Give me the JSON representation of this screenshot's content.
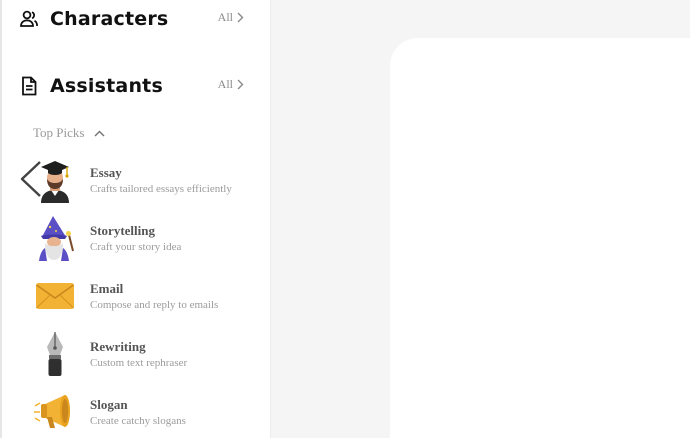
{
  "sections": {
    "characters": {
      "title": "Characters",
      "all_label": "All"
    },
    "assistants": {
      "title": "Assistants",
      "all_label": "All"
    }
  },
  "top_picks": {
    "label": "Top Picks"
  },
  "assistants_list": [
    {
      "name": "Essay",
      "description": "Crafts tailored essays efficiently",
      "icon": "graduate-icon"
    },
    {
      "name": "Storytelling",
      "description": "Craft your story idea",
      "icon": "wizard-icon"
    },
    {
      "name": "Email",
      "description": "Compose and reply to emails",
      "icon": "envelope-icon"
    },
    {
      "name": "Rewriting",
      "description": "Custom text rephraser",
      "icon": "fountain-pen-icon"
    },
    {
      "name": "Slogan",
      "description": "Create catchy slogans",
      "icon": "megaphone-icon"
    }
  ],
  "colors": {
    "page_bg": "#f5f5f5",
    "panel_bg": "#ffffff",
    "muted_text": "#9b9b9b",
    "envelope": "#f2b233"
  }
}
